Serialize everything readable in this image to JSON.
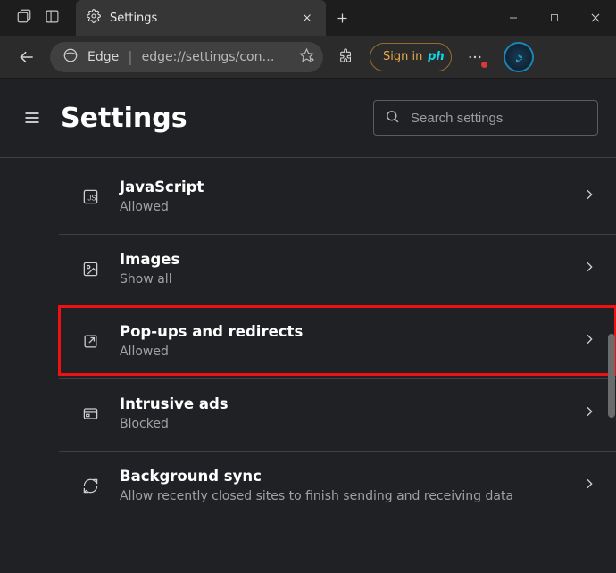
{
  "tab": {
    "title": "Settings"
  },
  "addr": {
    "app": "Edge",
    "url": "edge://settings/con…"
  },
  "signin": {
    "label": "Sign in",
    "badge": "ph"
  },
  "settings_title": "Settings",
  "search": {
    "placeholder": "Search settings"
  },
  "items": [
    {
      "title": "JavaScript",
      "sub": "Allowed"
    },
    {
      "title": "Images",
      "sub": "Show all"
    },
    {
      "title": "Pop-ups and redirects",
      "sub": "Allowed"
    },
    {
      "title": "Intrusive ads",
      "sub": "Blocked"
    },
    {
      "title": "Background sync",
      "sub": "Allow recently closed sites to finish sending and receiving data"
    }
  ]
}
